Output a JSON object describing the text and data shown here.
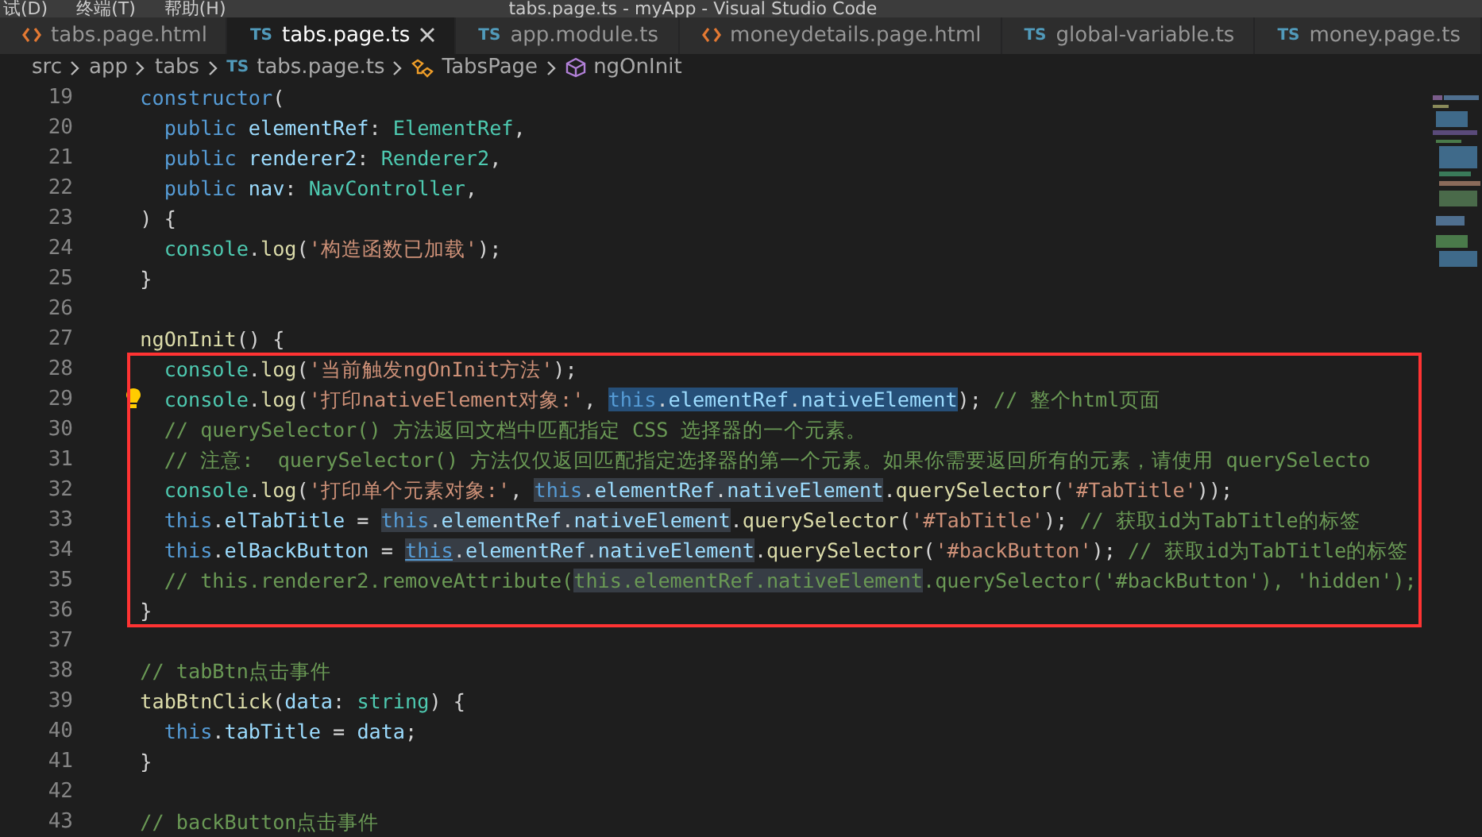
{
  "title_bar": {
    "menus": [
      "试(D)",
      "终端(T)",
      "帮助(H)"
    ],
    "title": "tabs.page.ts - myApp - Visual Studio Code"
  },
  "tabs": [
    {
      "kind": "html",
      "label": "tabs.page.html",
      "selected": false
    },
    {
      "kind": "ts",
      "badge": "TS",
      "label": "tabs.page.ts",
      "selected": true
    },
    {
      "kind": "ts",
      "badge": "TS",
      "label": "app.module.ts",
      "selected": false
    },
    {
      "kind": "html",
      "label": "moneydetails.page.html",
      "selected": false
    },
    {
      "kind": "ts",
      "badge": "TS",
      "label": "global-variable.ts",
      "selected": false
    },
    {
      "kind": "ts",
      "badge": "TS",
      "label": "money.page.ts",
      "selected": false
    }
  ],
  "breadcrumbs": [
    {
      "kind": "folder",
      "label": "src"
    },
    {
      "kind": "folder",
      "label": "app"
    },
    {
      "kind": "folder",
      "label": "tabs"
    },
    {
      "kind": "ts",
      "badge": "TS",
      "label": "tabs.page.ts"
    },
    {
      "kind": "class",
      "label": "TabsPage"
    },
    {
      "kind": "method",
      "label": "ngOnInit"
    }
  ],
  "lines": [
    {
      "number": "19",
      "tokens": [
        {
          "kind": "keyword",
          "text": "  constructor"
        },
        {
          "kind": "punctuation",
          "text": "("
        }
      ]
    },
    {
      "number": "20",
      "tokens": [
        {
          "kind": "keyword",
          "text": "    public "
        },
        {
          "kind": "variable",
          "text": "elementRef"
        },
        {
          "kind": "punctuation",
          "text": ": "
        },
        {
          "kind": "type",
          "text": "ElementRef"
        },
        {
          "kind": "punctuation",
          "text": ","
        }
      ]
    },
    {
      "number": "21",
      "tokens": [
        {
          "kind": "keyword",
          "text": "    public "
        },
        {
          "kind": "variable",
          "text": "renderer2"
        },
        {
          "kind": "punctuation",
          "text": ": "
        },
        {
          "kind": "type",
          "text": "Renderer2"
        },
        {
          "kind": "punctuation",
          "text": ","
        }
      ]
    },
    {
      "number": "22",
      "tokens": [
        {
          "kind": "keyword",
          "text": "    public "
        },
        {
          "kind": "variable",
          "text": "nav"
        },
        {
          "kind": "punctuation",
          "text": ": "
        },
        {
          "kind": "type",
          "text": "NavController"
        },
        {
          "kind": "punctuation",
          "text": ","
        }
      ]
    },
    {
      "number": "23",
      "tokens": [
        {
          "kind": "punctuation",
          "text": "  ) {"
        }
      ]
    },
    {
      "number": "24",
      "tokens": [
        {
          "kind": "type",
          "text": "    console"
        },
        {
          "kind": "punctuation",
          "text": "."
        },
        {
          "kind": "function",
          "text": "log"
        },
        {
          "kind": "punctuation",
          "text": "("
        },
        {
          "kind": "string",
          "text": "'构造函数已加载'"
        },
        {
          "kind": "punctuation",
          "text": ");"
        }
      ]
    },
    {
      "number": "25",
      "tokens": [
        {
          "kind": "punctuation",
          "text": "  }"
        }
      ]
    },
    {
      "number": "26"
    },
    {
      "number": "27",
      "tokens": [
        {
          "kind": "function",
          "text": "  ngOnInit"
        },
        {
          "kind": "punctuation",
          "text": "() {"
        }
      ]
    },
    {
      "number": "28",
      "tokens": [
        {
          "kind": "type",
          "text": "    console"
        },
        {
          "kind": "punctuation",
          "text": "."
        },
        {
          "kind": "function",
          "text": "log"
        },
        {
          "kind": "punctuation",
          "text": "("
        },
        {
          "kind": "string",
          "text": "'当前触发ngOnInit方法'"
        },
        {
          "kind": "punctuation",
          "text": ");"
        }
      ]
    },
    {
      "number": "29",
      "lightbulb": true,
      "tokens": [
        {
          "kind": "type",
          "text": "    console"
        },
        {
          "kind": "punctuation",
          "text": "."
        },
        {
          "kind": "function",
          "text": "log"
        },
        {
          "kind": "punctuation",
          "text": "("
        },
        {
          "kind": "string",
          "text": "'打印nativeElement对象:'"
        },
        {
          "kind": "punctuation",
          "text": ", "
        },
        {
          "kind": "keyword",
          "text": "this",
          "selected": true
        },
        {
          "kind": "punctuation",
          "text": ".",
          "selected": true
        },
        {
          "kind": "variable",
          "text": "elementRef",
          "selected": true
        },
        {
          "kind": "punctuation",
          "text": ".",
          "selected": true
        },
        {
          "kind": "variable",
          "text": "nativeElement",
          "selected": true
        },
        {
          "kind": "punctuation",
          "text": "); "
        },
        {
          "kind": "comment",
          "text": "// 整个html页面"
        }
      ]
    },
    {
      "number": "30",
      "tokens": [
        {
          "kind": "comment",
          "text": "    // querySelector() 方法返回文档中匹配指定 CSS 选择器的一个元素。"
        }
      ]
    },
    {
      "number": "31",
      "tokens": [
        {
          "kind": "comment",
          "text": "    // 注意:  querySelector() 方法仅仅返回匹配指定选择器的第一个元素。如果你需要返回所有的元素，请使用 querySelecto"
        }
      ]
    },
    {
      "number": "32",
      "tokens": [
        {
          "kind": "type",
          "text": "    console"
        },
        {
          "kind": "punctuation",
          "text": "."
        },
        {
          "kind": "function",
          "text": "log"
        },
        {
          "kind": "punctuation",
          "text": "("
        },
        {
          "kind": "string",
          "text": "'打印单个元素对象:'"
        },
        {
          "kind": "punctuation",
          "text": ", "
        },
        {
          "kind": "keyword",
          "text": "this",
          "highlighted": true
        },
        {
          "kind": "punctuation",
          "text": ".",
          "highlighted": true
        },
        {
          "kind": "variable",
          "text": "elementRef",
          "highlighted": true
        },
        {
          "kind": "punctuation",
          "text": ".",
          "highlighted": true
        },
        {
          "kind": "variable",
          "text": "nativeElement",
          "highlighted": true
        },
        {
          "kind": "punctuation",
          "text": "."
        },
        {
          "kind": "function",
          "text": "querySelector"
        },
        {
          "kind": "punctuation",
          "text": "("
        },
        {
          "kind": "string",
          "text": "'#TabTitle'"
        },
        {
          "kind": "punctuation",
          "text": "));"
        }
      ]
    },
    {
      "number": "33",
      "tokens": [
        {
          "kind": "keyword",
          "text": "    this"
        },
        {
          "kind": "punctuation",
          "text": "."
        },
        {
          "kind": "variable",
          "text": "elTabTitle"
        },
        {
          "kind": "punctuation",
          "text": " = "
        },
        {
          "kind": "keyword",
          "text": "this",
          "highlighted": true
        },
        {
          "kind": "punctuation",
          "text": ".",
          "highlighted": true
        },
        {
          "kind": "variable",
          "text": "elementRef",
          "highlighted": true
        },
        {
          "kind": "punctuation",
          "text": ".",
          "highlighted": true
        },
        {
          "kind": "variable",
          "text": "nativeElement",
          "highlighted": true
        },
        {
          "kind": "punctuation",
          "text": "."
        },
        {
          "kind": "function",
          "text": "querySelector"
        },
        {
          "kind": "punctuation",
          "text": "("
        },
        {
          "kind": "string",
          "text": "'#TabTitle'"
        },
        {
          "kind": "punctuation",
          "text": "); "
        },
        {
          "kind": "comment",
          "text": "// 获取id为TabTitle的标签"
        }
      ]
    },
    {
      "number": "34",
      "tokens": [
        {
          "kind": "keyword",
          "text": "    this"
        },
        {
          "kind": "punctuation",
          "text": "."
        },
        {
          "kind": "variable",
          "text": "elBackButton"
        },
        {
          "kind": "punctuation",
          "text": " = "
        },
        {
          "kind": "keyword",
          "text": "this",
          "highlighted": true,
          "underline": true
        },
        {
          "kind": "punctuation",
          "text": ".",
          "highlighted": true
        },
        {
          "kind": "variable",
          "text": "elementRef",
          "highlighted": true
        },
        {
          "kind": "punctuation",
          "text": ".",
          "highlighted": true
        },
        {
          "kind": "variable",
          "text": "nativeElement",
          "highlighted": true
        },
        {
          "kind": "punctuation",
          "text": "."
        },
        {
          "kind": "function",
          "text": "querySelector"
        },
        {
          "kind": "punctuation",
          "text": "("
        },
        {
          "kind": "string",
          "text": "'#backButton'"
        },
        {
          "kind": "punctuation",
          "text": "); "
        },
        {
          "kind": "comment",
          "text": "// 获取id为TabTitle的标签"
        }
      ]
    },
    {
      "number": "35",
      "tokens": [
        {
          "kind": "comment",
          "text": "    // this.renderer2.removeAttribute("
        },
        {
          "kind": "comment",
          "text": "this.elementRef.nativeElement",
          "highlighted": true
        },
        {
          "kind": "comment",
          "text": ".querySelector('#backButton'), 'hidden');"
        }
      ]
    },
    {
      "number": "36",
      "tokens": [
        {
          "kind": "punctuation",
          "text": "  }"
        }
      ]
    },
    {
      "number": "37"
    },
    {
      "number": "38",
      "tokens": [
        {
          "kind": "comment",
          "text": "  // tabBtn点击事件"
        }
      ]
    },
    {
      "number": "39",
      "tokens": [
        {
          "kind": "function",
          "text": "  tabBtnClick"
        },
        {
          "kind": "punctuation",
          "text": "("
        },
        {
          "kind": "variable",
          "text": "data"
        },
        {
          "kind": "punctuation",
          "text": ": "
        },
        {
          "kind": "type",
          "text": "string"
        },
        {
          "kind": "punctuation",
          "text": ") {"
        }
      ]
    },
    {
      "number": "40",
      "tokens": [
        {
          "kind": "keyword",
          "text": "    this"
        },
        {
          "kind": "punctuation",
          "text": "."
        },
        {
          "kind": "variable",
          "text": "tabTitle"
        },
        {
          "kind": "punctuation",
          "text": " = "
        },
        {
          "kind": "variable",
          "text": "data"
        },
        {
          "kind": "punctuation",
          "text": ";"
        }
      ]
    },
    {
      "number": "41",
      "tokens": [
        {
          "kind": "punctuation",
          "text": "  }"
        }
      ]
    },
    {
      "number": "42"
    },
    {
      "number": "43",
      "tokens": [
        {
          "kind": "comment",
          "text": "  // backButton点击事件"
        }
      ]
    }
  ]
}
